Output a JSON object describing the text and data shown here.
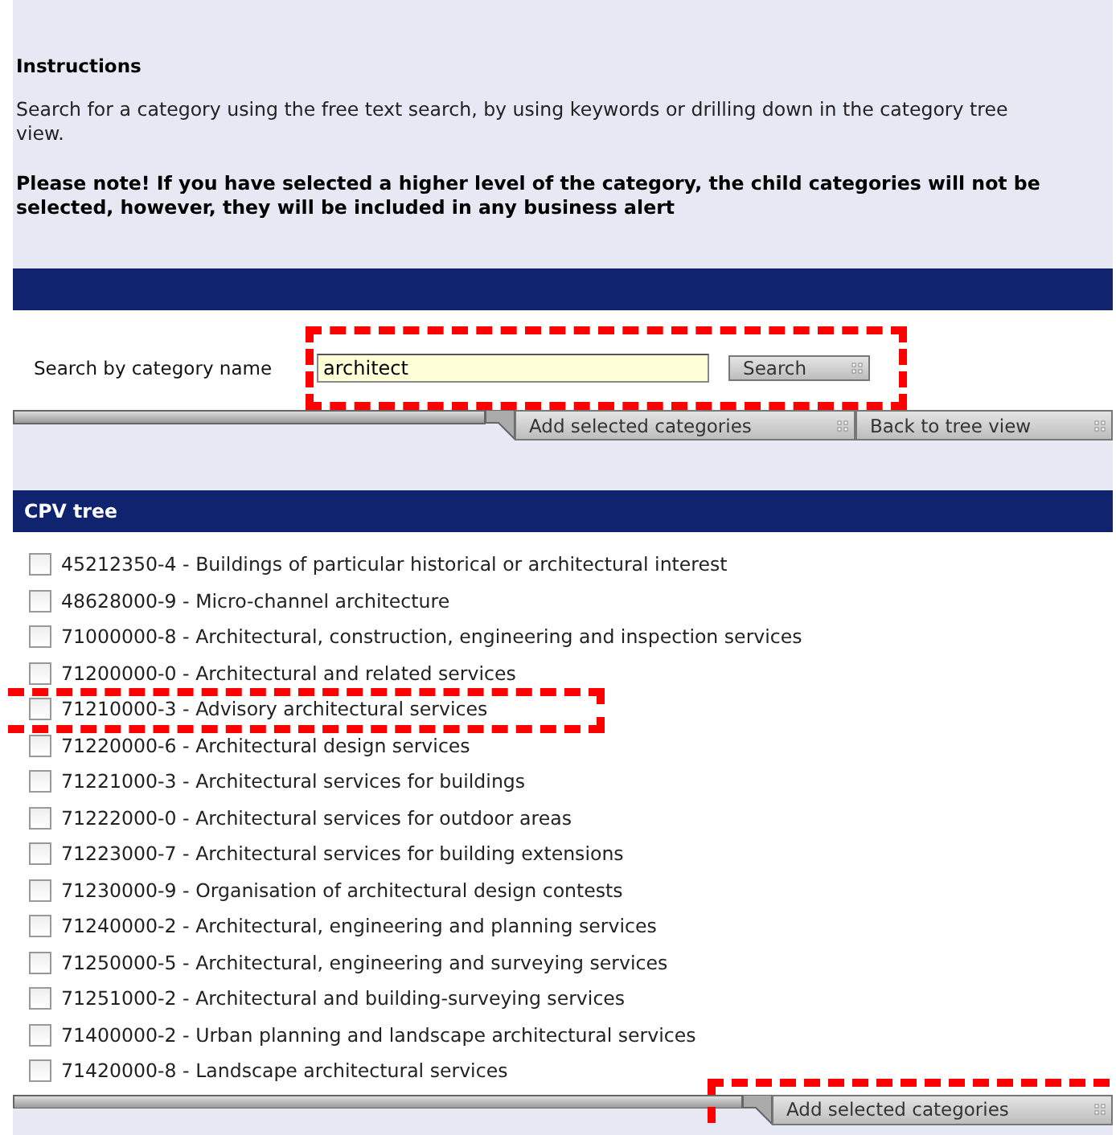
{
  "instructions": {
    "title": "Instructions",
    "text": "Search for a category using the free text search, by using keywords or drilling down in the category tree view.",
    "note": "Please note! If you have selected a higher level of the category, the child categories will not be selected, however, they will be included in any business alert"
  },
  "search": {
    "label": "Search by category name",
    "value": "architect",
    "button": "Search",
    "actions": [
      "Add selected categories",
      "Back to tree view"
    ]
  },
  "tree": {
    "title": "CPV tree",
    "items": [
      {
        "label": "45212350-4 - Buildings of particular historical or architectural interest",
        "checked": false
      },
      {
        "label": "48628000-9 - Micro-channel architecture",
        "checked": false
      },
      {
        "label": "71000000-8 - Architectural, construction, engineering and inspection services",
        "checked": false
      },
      {
        "label": "71200000-0 - Architectural and related services",
        "checked": false
      },
      {
        "label": "71210000-3 - Advisory architectural services",
        "checked": false
      },
      {
        "label": "71220000-6 - Architectural design services",
        "checked": false
      },
      {
        "label": "71221000-3 - Architectural services for buildings",
        "checked": false
      },
      {
        "label": "71222000-0 - Architectural services for outdoor areas",
        "checked": false
      },
      {
        "label": "71223000-7 - Architectural services for building extensions",
        "checked": false
      },
      {
        "label": "71230000-9 - Organisation of architectural design contests",
        "checked": false
      },
      {
        "label": "71240000-2 - Architectural, engineering and planning services",
        "checked": false
      },
      {
        "label": "71250000-5 - Architectural, engineering and surveying services",
        "checked": false
      },
      {
        "label": "71251000-2 - Architectural and building-surveying services",
        "checked": false
      },
      {
        "label": "71400000-2 - Urban planning and landscape architectural services",
        "checked": false
      },
      {
        "label": "71420000-8 - Landscape architectural services",
        "checked": false
      }
    ],
    "actions": [
      "Add selected categories"
    ]
  }
}
